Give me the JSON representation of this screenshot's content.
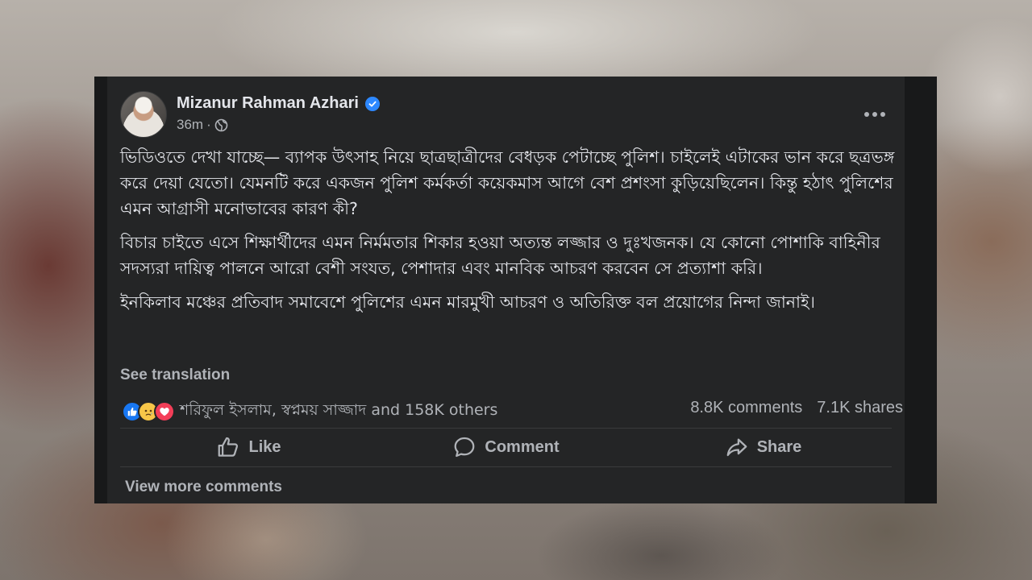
{
  "post": {
    "author": "Mizanur Rahman Azhari",
    "time": "36m",
    "separator": "·",
    "paragraphs": [
      "ভিডিওতে দেখা যাচ্ছে— ব্যাপক উৎসাহ নিয়ে ছাত্রছাত্রীদের বেধড়ক পেটাচ্ছে পুলিশ। চাইলেই এটাকের ভান করে ছত্রভঙ্গ করে দেয়া যেতো। যেমনটি করে একজন পুলিশ কর্মকর্তা কয়েকমাস আগে বেশ প্রশংসা কুড়িয়েছিলেন। কিন্তু হঠাৎ পুলিশের এমন আগ্রাসী মনোভাবের কারণ কী?",
      "বিচার চাইতে এসে শিক্ষার্থীদের এমন নির্মমতার শিকার হওয়া অত্যন্ত লজ্জার ও দুঃখজনক। যে কোনো পোশাকি বাহিনীর সদস্যরা দায়িত্ব পালনে আরো বেশী সংযত, পেশাদার এবং মানবিক আচরণ করবেন সে প্রত্যাশা করি।",
      "ইনকিলাব মঞ্চের প্রতিবাদ সমাবেশে পুলিশের এমন মারমুখী আচরণ ও অতিরিক্ত বল প্রয়োগের নিন্দা জানাই।"
    ],
    "see_translation": "See translation",
    "reactions_text": "শরিফুল ইসলাম, স্বপ্নময় সাজ্জাদ and 158K others",
    "comments_count": "8.8K comments",
    "shares_count": "7.1K shares",
    "actions": {
      "like": "Like",
      "comment": "Comment",
      "share": "Share"
    },
    "view_more": "View more comments"
  },
  "icons": {
    "verified": "verified-badge-icon",
    "privacy": "globe-icon",
    "menu": "more-options-icon",
    "reactions": [
      "like-reaction-icon",
      "sad-reaction-icon",
      "love-reaction-icon"
    ]
  },
  "colors": {
    "card_bg": "#242526",
    "text_primary": "#e4e6eb",
    "text_secondary": "#b0b3b8",
    "verified_blue": "#2d88ff",
    "like_blue": "#1877f2",
    "sad_yellow": "#f7c648",
    "love_red": "#f33e58"
  }
}
